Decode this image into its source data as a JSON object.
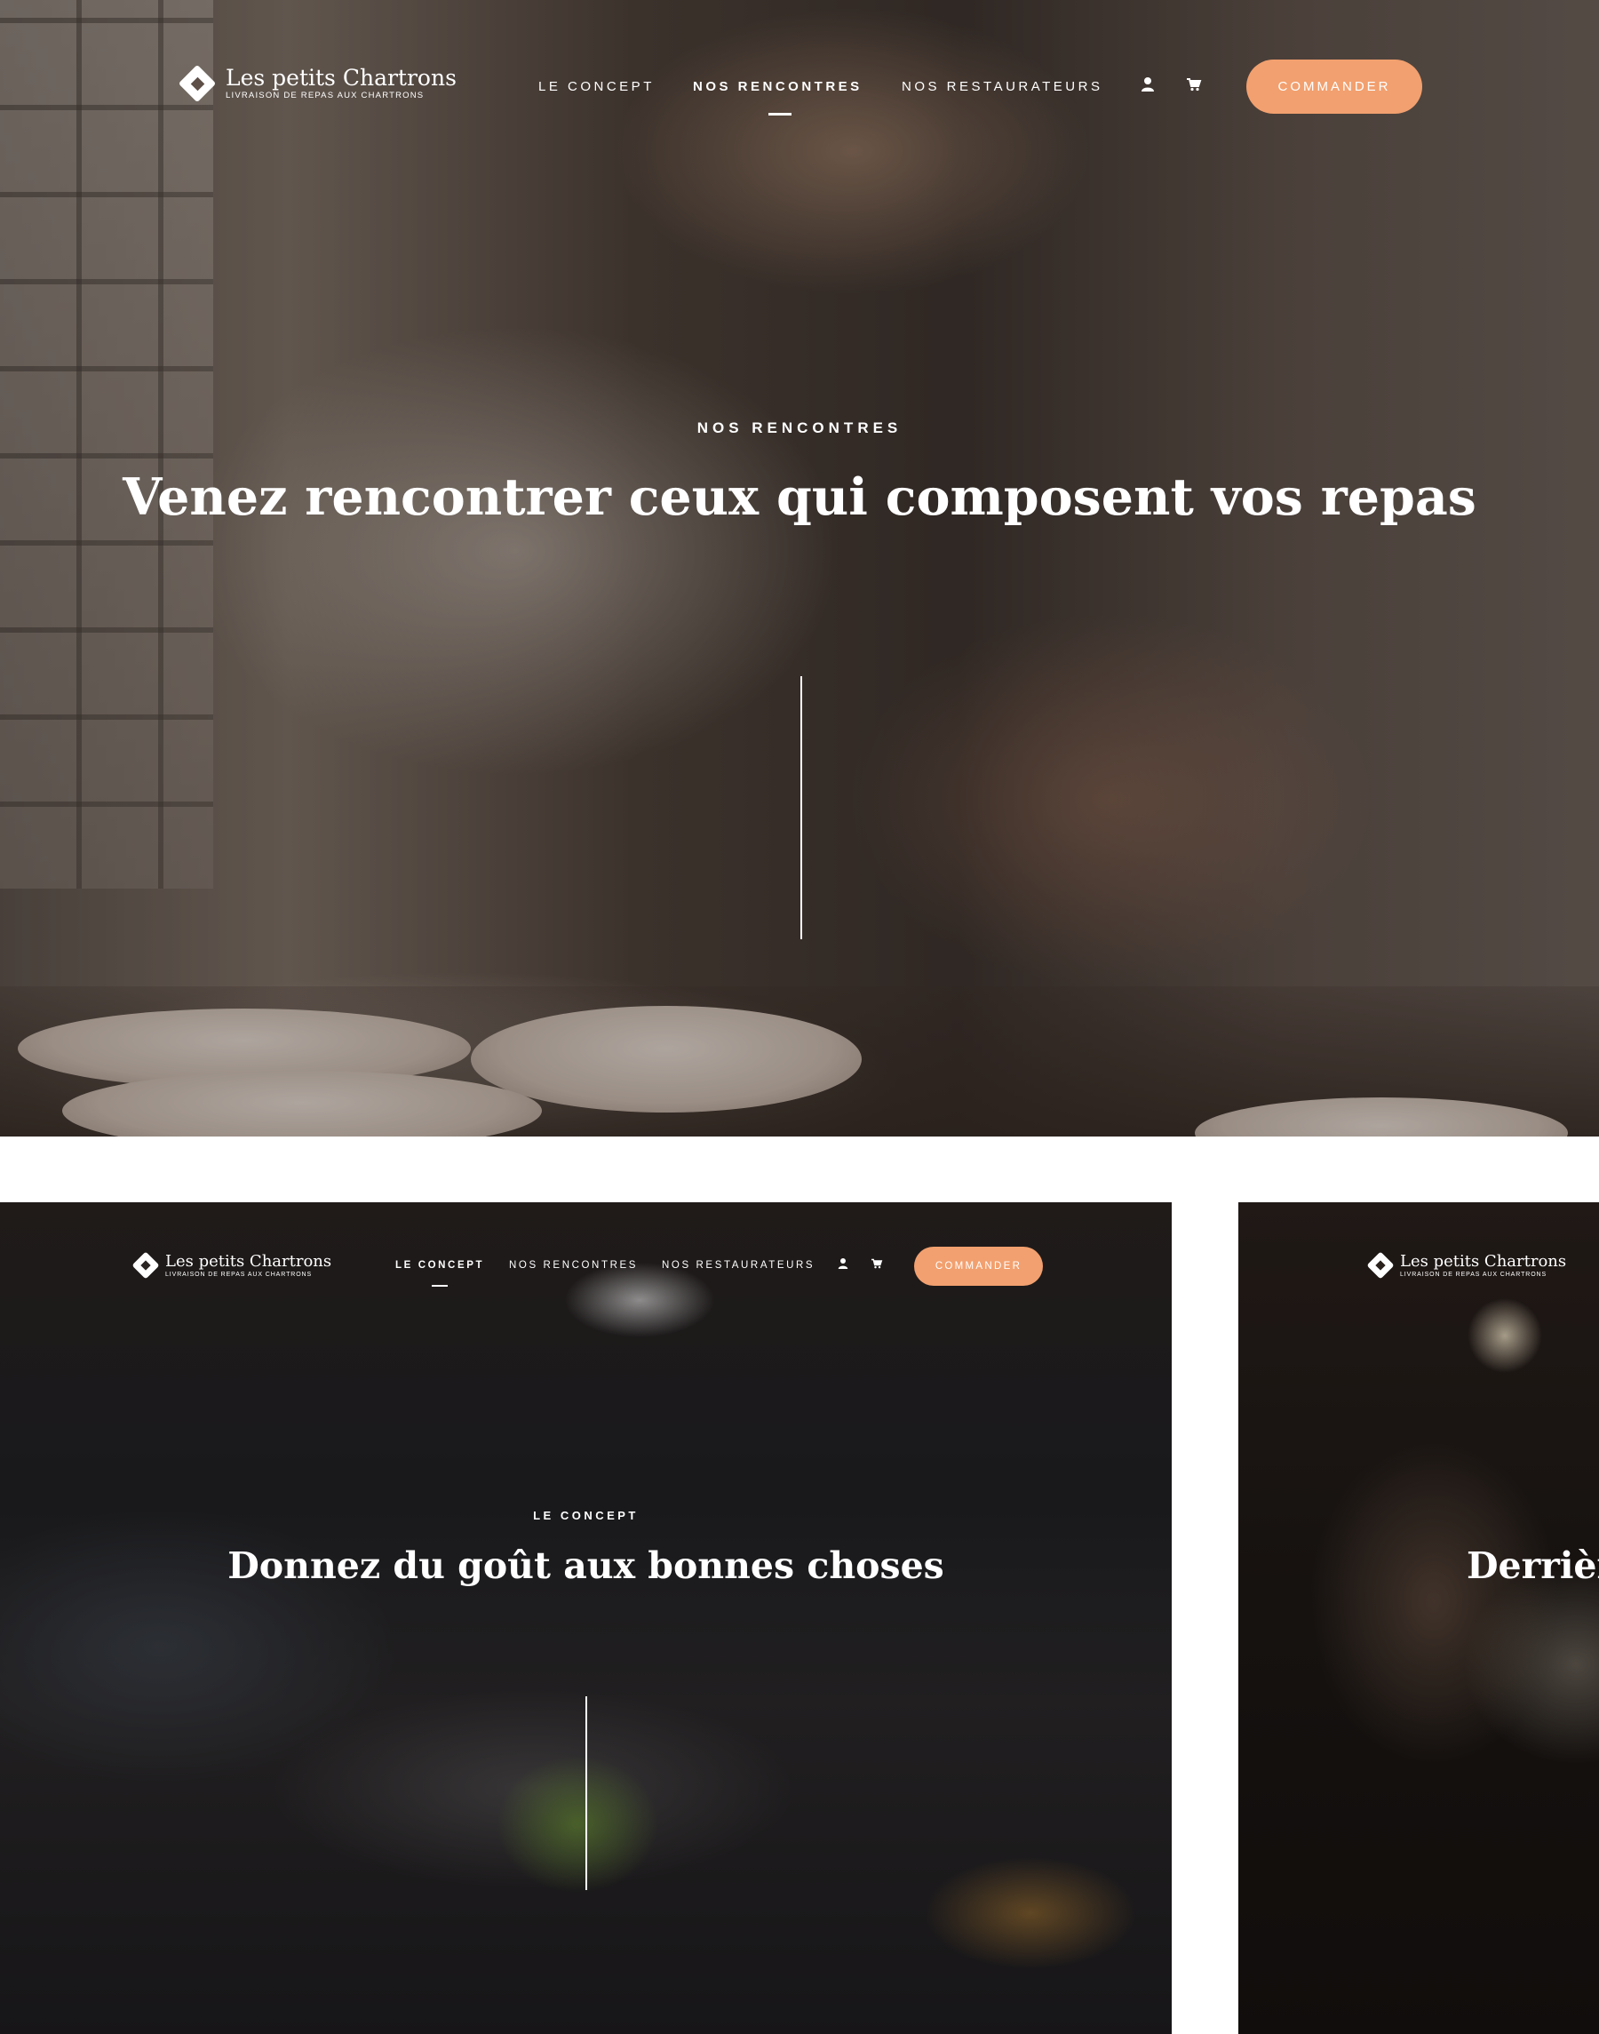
{
  "brand": {
    "name": "Les petits Chartrons",
    "tagline": "LIVRAISON DE REPAS AUX CHARTRONS",
    "accent_color": "#f2a06f"
  },
  "nav": {
    "links": [
      "LE CONCEPT",
      "NOS RENCONTRES",
      "NOS RESTAURATEURS"
    ],
    "user_icon": "user-icon",
    "cart_icon": "cart-icon",
    "cta_label": "COMMANDER"
  },
  "hero": {
    "active_link": "NOS RENCONTRES",
    "eyebrow": "NOS RENCONTRES",
    "headline": "Venez rencontrer ceux qui composent vos repas"
  },
  "card_left": {
    "active_link": "LE CONCEPT",
    "eyebrow": "LE CONCEPT",
    "headline": "Donnez du goût aux bonnes choses"
  },
  "card_right": {
    "headline": "Derrièr"
  }
}
